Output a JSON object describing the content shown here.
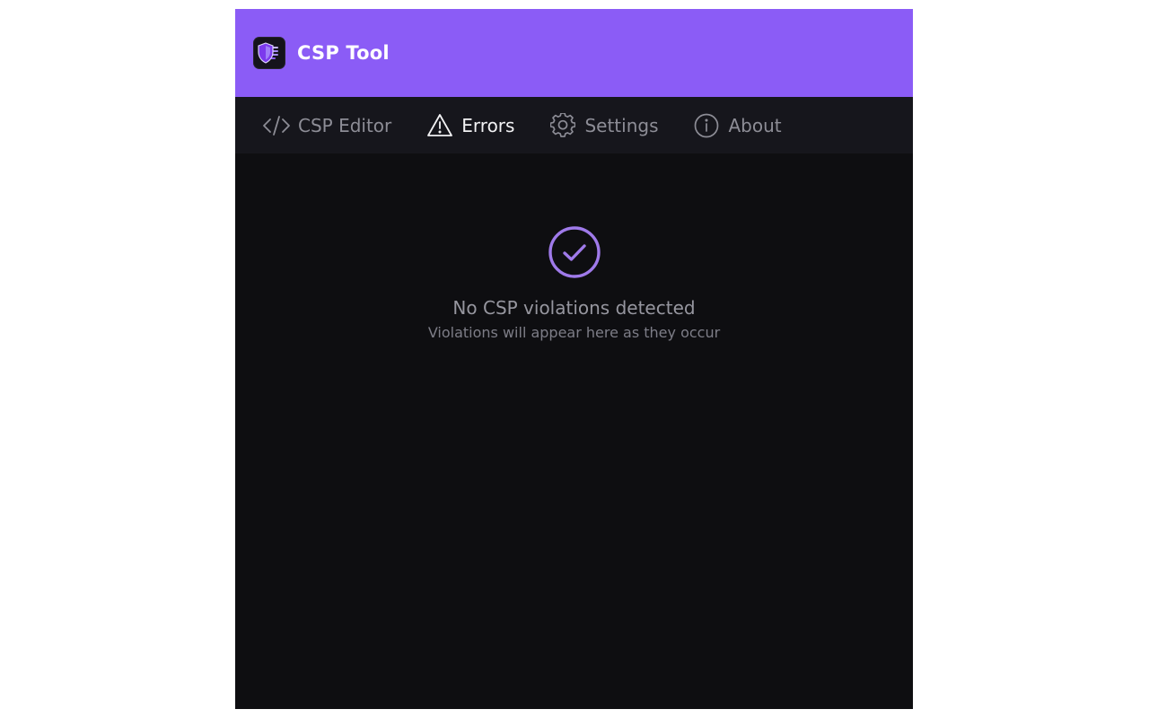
{
  "app": {
    "title": "CSP Tool",
    "logo_icon": "shield-document-icon",
    "accent_color": "#8b5cf6"
  },
  "tabs": [
    {
      "label": "CSP Editor",
      "icon": "code-icon",
      "active": false
    },
    {
      "label": "Errors",
      "icon": "warning-triangle-icon",
      "active": true
    },
    {
      "label": "Settings",
      "icon": "gear-icon",
      "active": false
    },
    {
      "label": "About",
      "icon": "info-icon",
      "active": false
    }
  ],
  "errors_view": {
    "status_icon": "check-circle-icon",
    "title": "No CSP violations detected",
    "subtitle": "Violations will appear here as they occur"
  }
}
